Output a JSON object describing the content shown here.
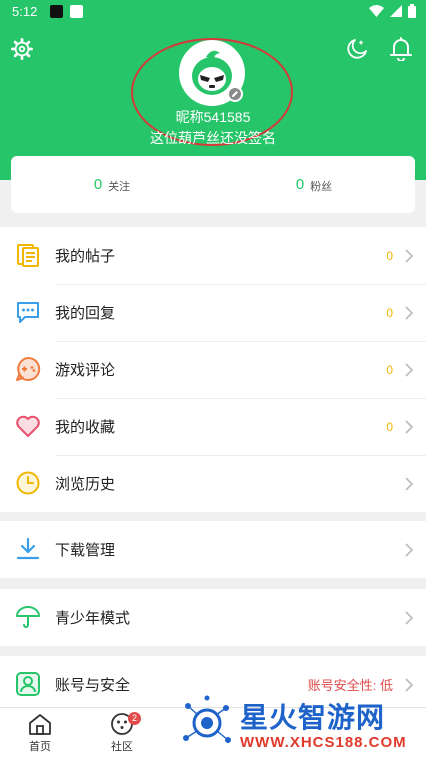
{
  "status_bar": {
    "time": "5:12"
  },
  "profile": {
    "nickname": "昵称541585",
    "signature": "这位葫芦丝还没签名"
  },
  "stats": [
    {
      "count": "0",
      "label": "关注"
    },
    {
      "count": "0",
      "label": "粉丝"
    }
  ],
  "menu": {
    "posts": {
      "label": "我的帖子",
      "count": "0"
    },
    "replies": {
      "label": "我的回复",
      "count": "0"
    },
    "game_reviews": {
      "label": "游戏评论",
      "count": "0"
    },
    "favorites": {
      "label": "我的收藏",
      "count": "0"
    },
    "history": {
      "label": "浏览历史"
    },
    "downloads": {
      "label": "下载管理"
    },
    "youth_mode": {
      "label": "青少年模式"
    },
    "account": {
      "label": "账号与安全",
      "security": "账号安全性: 低"
    }
  },
  "tabs": {
    "home": "首页",
    "community": "社区",
    "community_badge": "2"
  },
  "watermark": {
    "title": "星火智游网",
    "url": "WWW.XHCS188.COM"
  },
  "colors": {
    "brand_green": "#27c56a",
    "count_yellow": "#f0b600",
    "warning_red": "#e14b4b",
    "annotation_red": "#d53a3a"
  }
}
